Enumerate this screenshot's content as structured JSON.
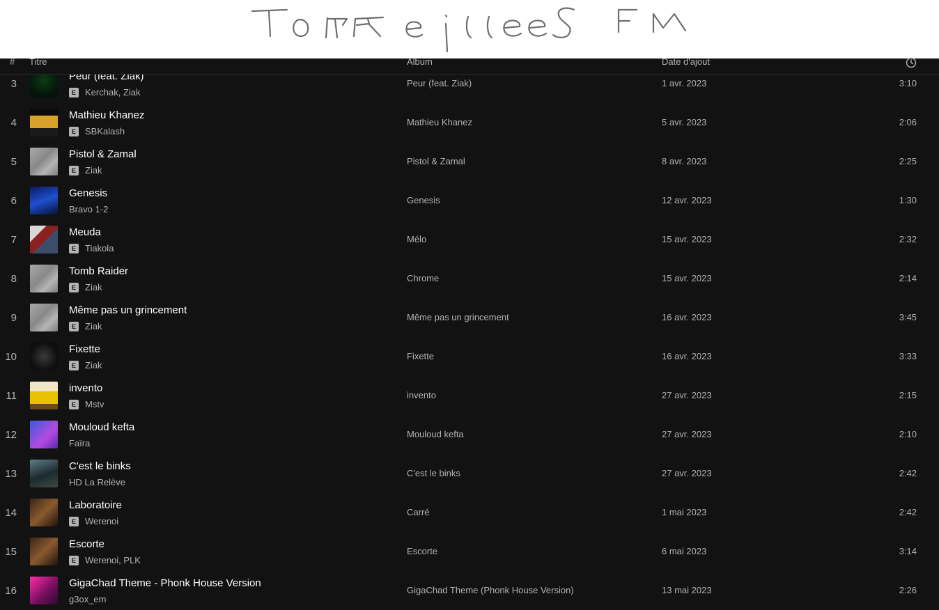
{
  "handwriting": "ToRReilles FM",
  "header": {
    "num": "#",
    "title": "Titre",
    "album": "Album",
    "date": "Date d'ajout",
    "duration_icon": "clock-icon"
  },
  "explicit_badge": "E",
  "tracks": [
    {
      "num": "3",
      "title": "Peur (feat. Ziak)",
      "artist": "Kerchak, Ziak",
      "explicit": true,
      "album": "Peur (feat. Ziak)",
      "date": "1 avr. 2023",
      "duration": "3:10",
      "cover": "c-peur"
    },
    {
      "num": "4",
      "title": "Mathieu Khanez",
      "artist": "SBKalash",
      "explicit": true,
      "album": "Mathieu Khanez",
      "date": "5 avr. 2023",
      "duration": "2:06",
      "cover": "c-khanez"
    },
    {
      "num": "5",
      "title": "Pistol & Zamal",
      "artist": "Ziak",
      "explicit": true,
      "album": "Pistol & Zamal",
      "date": "8 avr. 2023",
      "duration": "2:25",
      "cover": "c-grey"
    },
    {
      "num": "6",
      "title": "Genesis",
      "artist": "Bravo 1-2",
      "explicit": false,
      "album": "Genesis",
      "date": "12 avr. 2023",
      "duration": "1:30",
      "cover": "c-genesis"
    },
    {
      "num": "7",
      "title": "Meuda",
      "artist": "Tiakola",
      "explicit": true,
      "album": "Mélo",
      "date": "15 avr. 2023",
      "duration": "2:32",
      "cover": "c-meuda"
    },
    {
      "num": "8",
      "title": "Tomb Raider",
      "artist": "Ziak",
      "explicit": true,
      "album": "Chrome",
      "date": "15 avr. 2023",
      "duration": "2:14",
      "cover": "c-grey"
    },
    {
      "num": "9",
      "title": "Même pas un grincement",
      "artist": "Ziak",
      "explicit": true,
      "album": "Même pas un grincement",
      "date": "16 avr. 2023",
      "duration": "3:45",
      "cover": "c-grey"
    },
    {
      "num": "10",
      "title": "Fixette",
      "artist": "Ziak",
      "explicit": true,
      "album": "Fixette",
      "date": "16 avr. 2023",
      "duration": "3:33",
      "cover": "c-fixette"
    },
    {
      "num": "11",
      "title": "invento",
      "artist": "Mstv",
      "explicit": true,
      "album": "invento",
      "date": "27 avr. 2023",
      "duration": "2:15",
      "cover": "c-invento"
    },
    {
      "num": "12",
      "title": "Mouloud kefta",
      "artist": "Faïra",
      "explicit": false,
      "album": "Mouloud kefta",
      "date": "27 avr. 2023",
      "duration": "2:10",
      "cover": "c-mouloud"
    },
    {
      "num": "13",
      "title": "C'est le binks",
      "artist": "HD La Relève",
      "explicit": false,
      "album": "C'est le binks",
      "date": "27 avr. 2023",
      "duration": "2:42",
      "cover": "c-binks"
    },
    {
      "num": "14",
      "title": "Laboratoire",
      "artist": "Werenoi",
      "explicit": true,
      "album": "Carré",
      "date": "1 mai 2023",
      "duration": "2:42",
      "cover": "c-werenoi"
    },
    {
      "num": "15",
      "title": "Escorte",
      "artist": "Werenoi, PLK",
      "explicit": true,
      "album": "Escorte",
      "date": "6 mai 2023",
      "duration": "3:14",
      "cover": "c-werenoi"
    },
    {
      "num": "16",
      "title": "GigaChad Theme - Phonk House Version",
      "artist": "g3ox_em",
      "explicit": false,
      "album": "GigaChad Theme (Phonk House Version)",
      "date": "13 mai 2023",
      "duration": "2:26",
      "cover": "c-giga"
    }
  ]
}
